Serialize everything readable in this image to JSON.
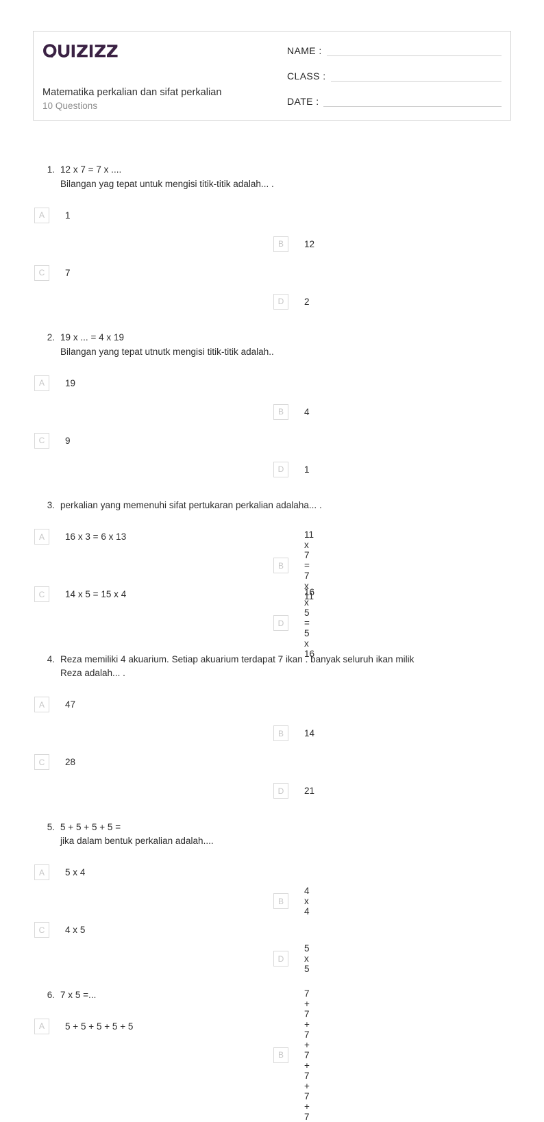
{
  "header": {
    "logo_text": "Quizizz",
    "logo_color": "#3b2244",
    "title": "Matematika perkalian dan sifat perkalian",
    "subtitle": "10 Questions",
    "fields": [
      {
        "label": "NAME :"
      },
      {
        "label": "CLASS :"
      },
      {
        "label": "DATE  :"
      }
    ]
  },
  "questions": [
    {
      "number": "1.",
      "lines": [
        "12 x 7 = 7 x ....",
        "Bilangan yag tepat untuk mengisi titik-titik adalah... ."
      ],
      "options": [
        {
          "letter": "A",
          "text": "1"
        },
        {
          "letter": "B",
          "text": "12"
        },
        {
          "letter": "C",
          "text": "7"
        },
        {
          "letter": "D",
          "text": "2"
        }
      ]
    },
    {
      "number": "2.",
      "lines": [
        "19 x ... = 4 x 19",
        "Bilangan yang tepat utnutk mengisi titik-titik adalah.."
      ],
      "options": [
        {
          "letter": "A",
          "text": "19"
        },
        {
          "letter": "B",
          "text": "4"
        },
        {
          "letter": "C",
          "text": "9"
        },
        {
          "letter": "D",
          "text": "1"
        }
      ]
    },
    {
      "number": "3.",
      "lines": [
        "perkalian yang memenuhi sifat pertukaran perkalian adalaha... ."
      ],
      "options": [
        {
          "letter": "A",
          "text": "16 x 3 = 6 x 13"
        },
        {
          "letter": "B",
          "text": "11 x 7 = 7 x 11"
        },
        {
          "letter": "C",
          "text": "14 x 5 = 15 x 4"
        },
        {
          "letter": "D",
          "text": "16 x 5 = 5 x 16"
        }
      ]
    },
    {
      "number": "4.",
      "lines": [
        "Reza memiliki 4 akuarium. Setiap akuarium terdapat 7 ikan . banyak seluruh ikan milik",
        "Reza adalah... ."
      ],
      "options": [
        {
          "letter": "A",
          "text": "47"
        },
        {
          "letter": "B",
          "text": "14"
        },
        {
          "letter": "C",
          "text": "28"
        },
        {
          "letter": "D",
          "text": "21"
        }
      ]
    },
    {
      "number": "5.",
      "lines": [
        "5 + 5 + 5 + 5 =",
        "jika dalam bentuk perkalian adalah...."
      ],
      "options": [
        {
          "letter": "A",
          "text": "5 x 4"
        },
        {
          "letter": "B",
          "text": "4 x 4"
        },
        {
          "letter": "C",
          "text": "4 x 5"
        },
        {
          "letter": "D",
          "text": "5 x 5"
        }
      ]
    },
    {
      "number": "6.",
      "lines": [
        "7 x 5 =..."
      ],
      "options": [
        {
          "letter": "A",
          "text": "5 + 5 + 5 + 5 + 5"
        },
        {
          "letter": "B",
          "text": "7 + 7 + 7 + 7 + 7 + 7 + 7"
        }
      ]
    }
  ]
}
